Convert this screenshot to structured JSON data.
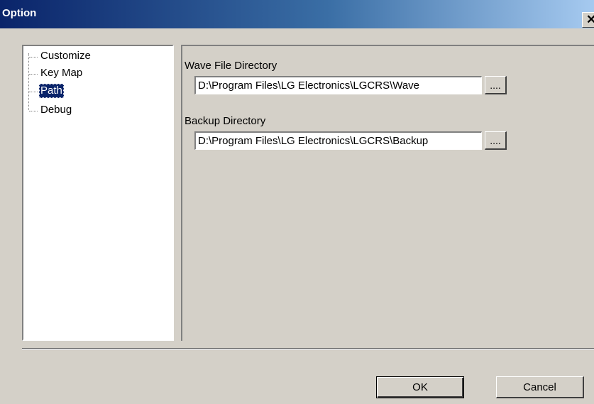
{
  "window": {
    "title": "Option",
    "close_glyph": "✕",
    "close_icon_name": "close-icon"
  },
  "tree": {
    "items": [
      {
        "label": "Customize",
        "selected": false
      },
      {
        "label": "Key Map",
        "selected": false
      },
      {
        "label": "Path",
        "selected": true
      },
      {
        "label": "Debug",
        "selected": false
      }
    ]
  },
  "path_page": {
    "wave_label": "Wave File Directory",
    "wave_value": "D:\\Program Files\\LG Electronics\\LGCRS\\Wave",
    "backup_label": "Backup Directory",
    "backup_value": "D:\\Program Files\\LG Electronics\\LGCRS\\Backup",
    "browse_label": "...."
  },
  "buttons": {
    "ok": "OK",
    "cancel": "Cancel"
  },
  "colors": {
    "titlebar_start": "#0a246a",
    "titlebar_end": "#a6caf0",
    "face": "#d4d0c8",
    "selection": "#0a246a"
  }
}
